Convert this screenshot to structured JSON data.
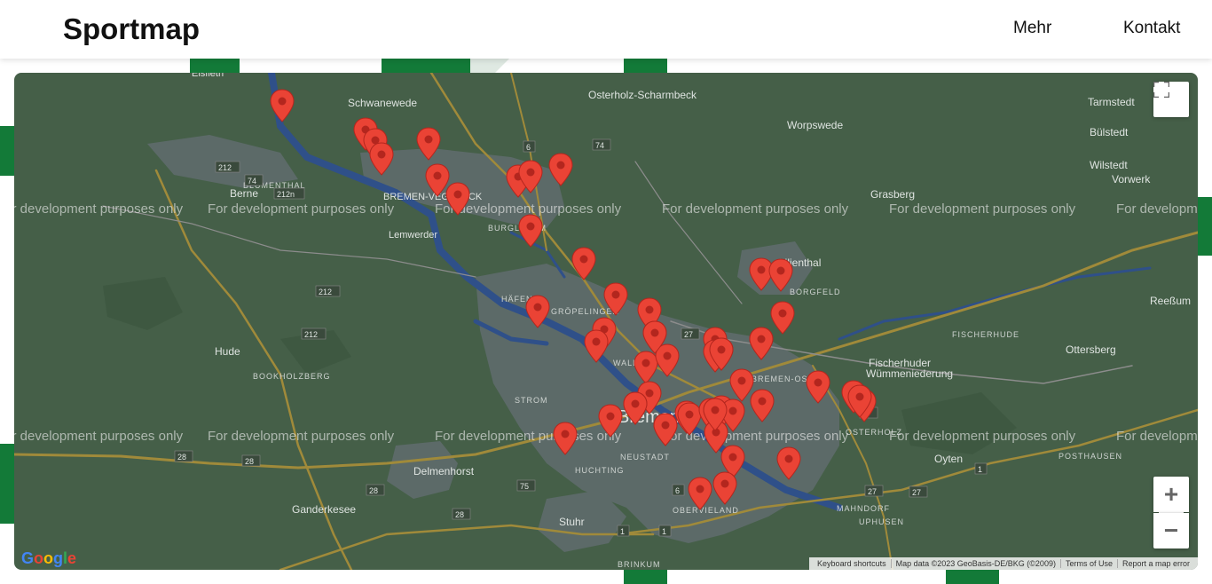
{
  "header": {
    "brand": "Sportmap",
    "nav": [
      {
        "label": "Mehr"
      },
      {
        "label": "Kontakt"
      }
    ]
  },
  "map": {
    "places": [
      {
        "name": "Osterholz-Scharmbeck",
        "size": 12
      },
      {
        "name": "Worpswede",
        "size": 12
      },
      {
        "name": "Tarmstedt",
        "size": 12
      },
      {
        "name": "Bülstedt",
        "size": 12
      },
      {
        "name": "Wilstedt",
        "size": 12
      },
      {
        "name": "Vorwerk",
        "size": 12
      },
      {
        "name": "Schwanewede",
        "size": 12
      },
      {
        "name": "Grasberg",
        "size": 12
      },
      {
        "name": "Berne",
        "size": 12
      },
      {
        "name": "Lemwerder",
        "size": 11
      },
      {
        "name": "Lilienthal",
        "size": 12
      },
      {
        "name": "Reeßum",
        "size": 12
      },
      {
        "name": "Hude",
        "size": 12
      },
      {
        "name": "Ottersberg",
        "size": 12
      },
      {
        "name": "Bremen",
        "size": 20
      },
      {
        "name": "Delmenhorst",
        "size": 12
      },
      {
        "name": "Oyten",
        "size": 12
      },
      {
        "name": "Ganderkesee",
        "size": 12
      },
      {
        "name": "Stuhr",
        "size": 12
      },
      {
        "name": "Elsfleth",
        "size": 11
      },
      {
        "name": "Fischerhuder",
        "size": 12
      },
      {
        "name": "Wümmeniederung",
        "size": 12
      },
      {
        "name": "BREMEN-VEGESACK",
        "size": 11
      },
      {
        "name": "Vegesack",
        "size": 11
      },
      {
        "name": "Burglesum",
        "size": 11
      }
    ],
    "districts": [
      "BURGLESUM",
      "HÄFEN",
      "GRÖPELINGEN",
      "WALLE",
      "BORGFELD",
      "BREMEN-OST",
      "FISCHERHUDE",
      "BOOKHOLZBERG",
      "STROM",
      "NEUSTADT",
      "HUCHTING",
      "OSTERHOLZ",
      "POSTHAUSEN",
      "MAHNDORF",
      "UPHUSEN",
      "OBERVIELAND",
      "BRINKUM",
      "BLUMENTHAL"
    ],
    "road_numbers": [
      "74",
      "6",
      "74",
      "212",
      "212n",
      "27",
      "212",
      "212",
      "28",
      "28",
      "28",
      "28",
      "27",
      "75",
      "1",
      "6",
      "1",
      "27",
      "27",
      "1"
    ],
    "watermark": "For development purposes only",
    "controls": {
      "fullscreen_icon": "fullscreen-icon",
      "zoom_in": "+",
      "zoom_out": "−"
    },
    "google_logo": "Google",
    "attribution": [
      {
        "label": "Keyboard shortcuts"
      },
      {
        "label": "Map data ©2023 GeoBasis-DE/BKG (©2009)"
      },
      {
        "label": "Terms of Use"
      },
      {
        "label": "Report a map error"
      }
    ],
    "marker_color": "#ea4335",
    "marker_count": 55
  },
  "colors": {
    "brand_green": "#137a38",
    "map_land": "#455f48",
    "map_water": "#2f5089",
    "map_urban": "#5c6a68"
  }
}
